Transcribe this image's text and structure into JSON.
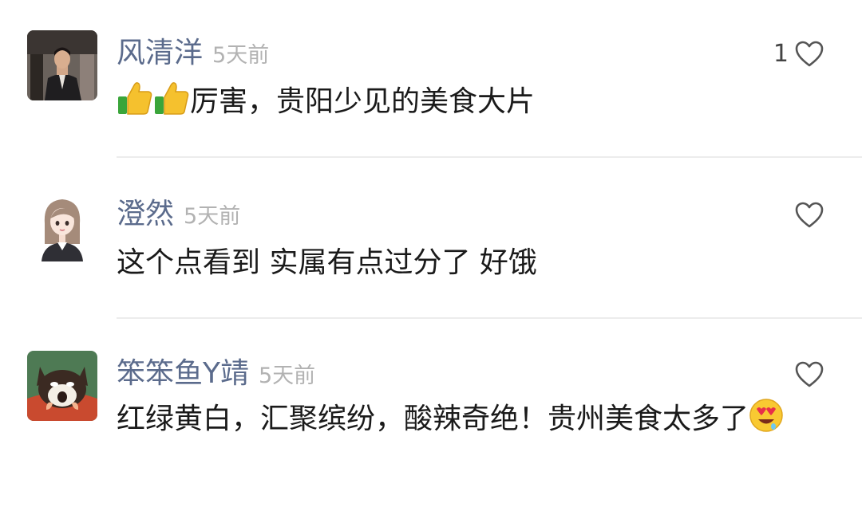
{
  "comments": [
    {
      "username": "风清洋",
      "time": "5天前",
      "text": "厉害，贵阳少见的美食大片",
      "like_count": "1",
      "avatar_icon": "man-in-suit-photo",
      "emojis": [
        "thumbs-up-icon",
        "thumbs-up-icon"
      ]
    },
    {
      "username": "澄然",
      "time": "5天前",
      "text": "这个点看到 实属有点过分了 好饿",
      "avatar_icon": "cartoon-girl-illustration"
    },
    {
      "username": "笨笨鱼Y靖",
      "time": "5天前",
      "text": "红绿黄白，汇聚缤纷，酸辣奇绝！贵州美食太多了",
      "avatar_icon": "cartoon-cat-illustration",
      "emojis": [
        "heart-eyes-drooling-face-icon"
      ]
    }
  ],
  "colors": {
    "username": "#5b6b8c",
    "time": "#b2b2b2",
    "text": "#1a1a1a",
    "divider": "#ececec"
  }
}
